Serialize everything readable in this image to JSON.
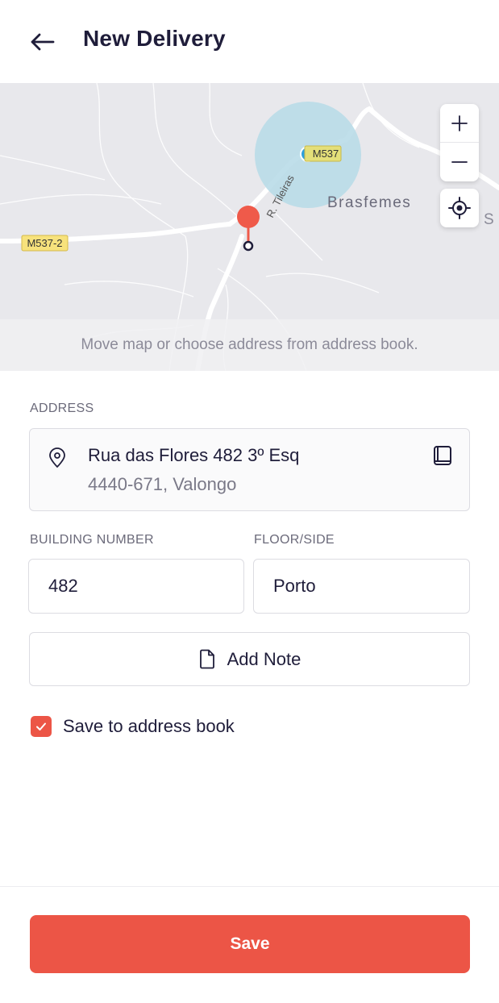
{
  "header": {
    "title": "New Delivery"
  },
  "map": {
    "hint": "Move map or choose address from address book.",
    "labels": {
      "road_m537_2": "M537-2",
      "road_m537": "M537",
      "street": "R. Tileiras",
      "place": "Brasfemes",
      "edge_partial": "S"
    },
    "colors": {
      "pin": "#ef5a4a",
      "accuracy_circle": "#b9dbe8",
      "user_dot": "#2e9fdc",
      "road_badge": "#f7e27c"
    }
  },
  "address": {
    "label": "ADDRESS",
    "line1": "Rua das Flores 482 3º Esq",
    "line2": "4440-671, Valongo"
  },
  "building_number": {
    "label": "BUILDING NUMBER",
    "value": "482"
  },
  "floor_side": {
    "label": "FLOOR/SIDE",
    "value": "Porto"
  },
  "note": {
    "label": "Add Note"
  },
  "save_to_book": {
    "label": "Save to address book",
    "checked": true
  },
  "save_button": {
    "label": "Save"
  },
  "colors": {
    "accent": "#ec5546",
    "text": "#1f1d3a",
    "muted": "#7a7988"
  }
}
